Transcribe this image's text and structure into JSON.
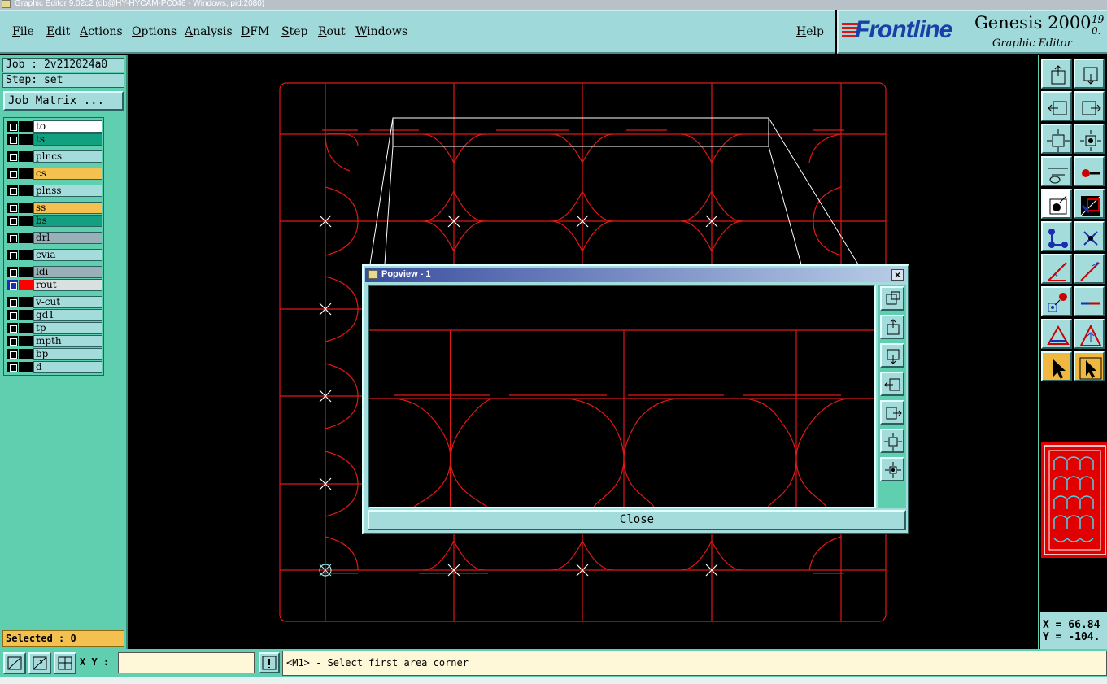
{
  "window": {
    "title": "Graphic Editor 9.02c2 (db@HY-HYCAM-PC046 - Windows, pid:2080)"
  },
  "menu": {
    "items": [
      "File",
      "Edit",
      "Actions",
      "Options",
      "Analysis",
      "DFM",
      "Step",
      "Rout",
      "Windows"
    ],
    "help": "Help"
  },
  "brand": {
    "logo": "Frontline",
    "product": "Genesis 2000",
    "version": "19 0.",
    "subtitle": "Graphic Editor"
  },
  "job": {
    "job_label": "Job : 2v212024a0",
    "step_label": "Step: set",
    "matrix_button": "Job Matrix ..."
  },
  "layers": [
    {
      "name": "to",
      "color": "#ffffff",
      "swatch": "#000000"
    },
    {
      "name": "ts",
      "color": "#12a080",
      "swatch": "#000000"
    },
    {
      "name": "plncs",
      "color": "#a4dcdc",
      "swatch": "#000000"
    },
    {
      "name": "cs",
      "color": "#f4c050",
      "swatch": "#000000"
    },
    {
      "name": "plnss",
      "color": "#a4dcdc",
      "swatch": "#000000"
    },
    {
      "name": "ss",
      "color": "#f4c050",
      "swatch": "#000000"
    },
    {
      "name": "bs",
      "color": "#12a080",
      "swatch": "#000000"
    },
    {
      "name": "drl",
      "color": "#9ab0b8",
      "swatch": "#000000"
    },
    {
      "name": "cvia",
      "color": "#a4dcdc",
      "swatch": "#000000"
    },
    {
      "name": "ldi",
      "color": "#9ab0b8",
      "swatch": "#000000"
    },
    {
      "name": "rout",
      "color": "#d8e0e0",
      "swatch": "#ff0000"
    },
    {
      "name": "v-cut",
      "color": "#a4dcdc",
      "swatch": "#000000"
    },
    {
      "name": "gd1",
      "color": "#a4dcdc",
      "swatch": "#000000"
    },
    {
      "name": "tp",
      "color": "#a4dcdc",
      "swatch": "#000000"
    },
    {
      "name": "mpth",
      "color": "#a4dcdc",
      "swatch": "#000000"
    },
    {
      "name": "bp",
      "color": "#a4dcdc",
      "swatch": "#000000"
    },
    {
      "name": "d",
      "color": "#a4dcdc",
      "swatch": "#000000"
    }
  ],
  "selected_label": "Selected : 0",
  "coords": {
    "x": "X = 66.84",
    "y": "Y = -104."
  },
  "status": {
    "xy_label": "X Y :",
    "xy_value": "",
    "message": "<M1> - Select first area corner"
  },
  "popview": {
    "title": "Popview - 1",
    "close_label": "Close"
  },
  "colors": {
    "rout_line": "#e01818",
    "teal": "#5fcfaf",
    "panel": "#a4dcdc",
    "highlight": "#f0b840"
  },
  "toolbar_icons": [
    "zoom-home-icon",
    "zoom-page-icon",
    "pan-left-icon",
    "pan-right-icon",
    "zoom-fit-icon",
    "zoom-center-icon",
    "measure-icon",
    "snap-icon",
    "select-pointer-icon",
    "color-layer-icon",
    "connect-nodes-icon",
    "cross-icon",
    "angle-tool-icon",
    "angle-arrow-icon",
    "node-select-icon",
    "line-tool-icon",
    "triangle-tool-icon",
    "triangle-arrow-icon",
    "cursor-icon",
    "cursor-box-icon"
  ]
}
